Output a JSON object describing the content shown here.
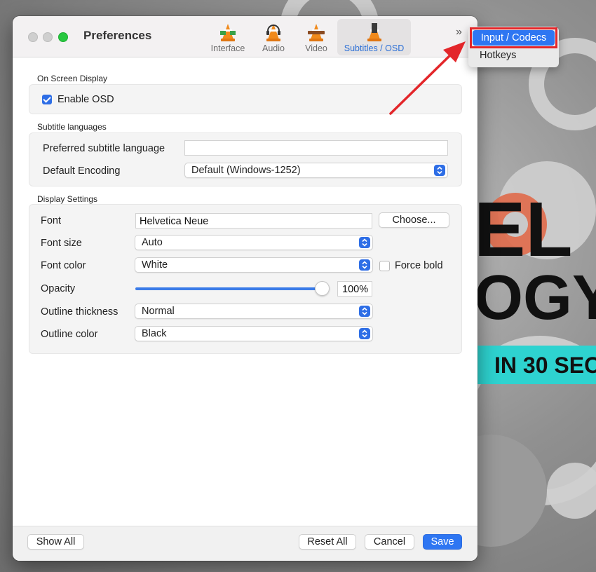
{
  "window": {
    "title": "Preferences"
  },
  "toolbar": {
    "tabs": [
      {
        "label": "Interface",
        "icon": "interface-cone-icon"
      },
      {
        "label": "Audio",
        "icon": "audio-cone-icon"
      },
      {
        "label": "Video",
        "icon": "video-cone-icon"
      },
      {
        "label": "Subtitles / OSD",
        "icon": "subtitles-cone-icon",
        "active": true
      }
    ],
    "overflow_symbol": "»"
  },
  "overflow_menu": {
    "items": [
      {
        "label": "Input / Codecs",
        "selected": true
      },
      {
        "label": "Hotkeys",
        "selected": false
      }
    ]
  },
  "osd": {
    "section_title": "On Screen Display",
    "enable_label": "Enable OSD",
    "enable_checked": true
  },
  "subtitle_languages": {
    "section_title": "Subtitle languages",
    "preferred_label": "Preferred subtitle language",
    "preferred_value": "",
    "encoding_label": "Default Encoding",
    "encoding_value": "Default (Windows-1252)"
  },
  "display": {
    "section_title": "Display Settings",
    "font_label": "Font",
    "font_value": "Helvetica Neue",
    "choose_label": "Choose...",
    "size_label": "Font size",
    "size_value": "Auto",
    "color_label": "Font color",
    "color_value": "White",
    "force_bold_label": "Force bold",
    "force_bold_checked": false,
    "opacity_label": "Opacity",
    "opacity_value": "100%",
    "opacity_fraction": 1.0,
    "outline_thickness_label": "Outline thickness",
    "outline_thickness_value": "Normal",
    "outline_color_label": "Outline color",
    "outline_color_value": "Black"
  },
  "footer": {
    "show_all": "Show All",
    "reset_all": "Reset All",
    "cancel": "Cancel",
    "save": "Save"
  },
  "background": {
    "banner_text_1": "EL",
    "banner_text_2": "OGY",
    "banner_text_3": "IN 30 SEC"
  },
  "colors": {
    "accent": "#2e76f2",
    "highlight_box": "#e3262a",
    "teal_banner": "#2ed3d0",
    "orange_gear": "#e06a4a"
  }
}
